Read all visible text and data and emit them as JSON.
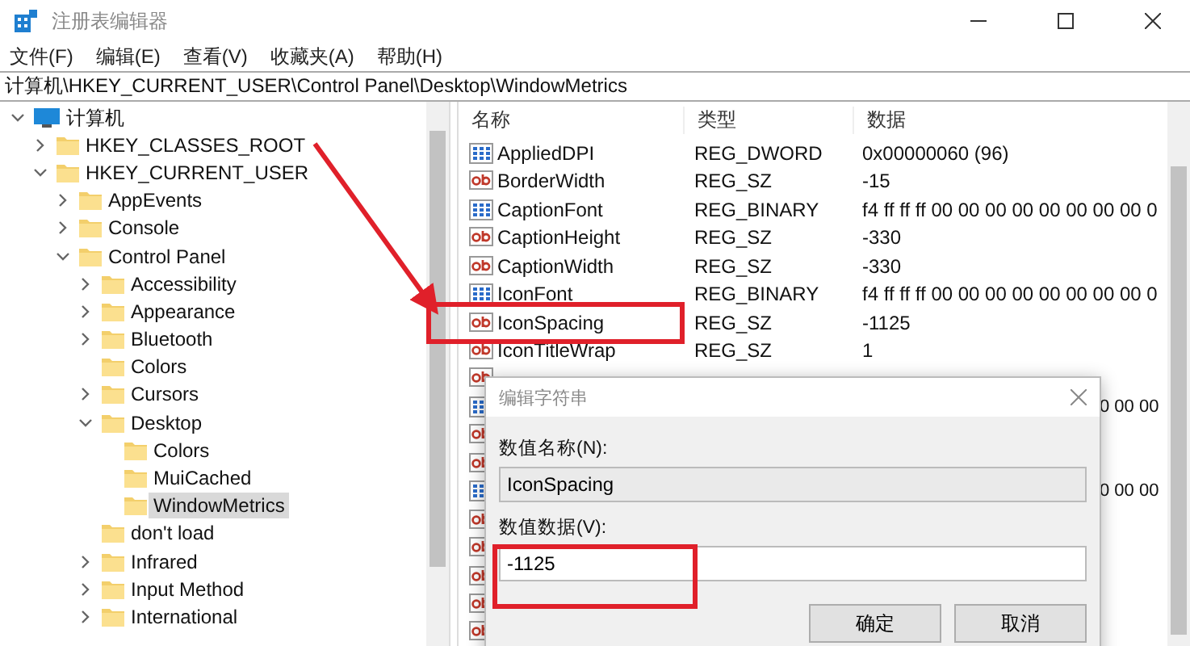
{
  "window": {
    "title": "注册表编辑器"
  },
  "menu": [
    "文件(F)",
    "编辑(E)",
    "查看(V)",
    "收藏夹(A)",
    "帮助(H)"
  ],
  "address": "计算机\\HKEY_CURRENT_USER\\Control Panel\\Desktop\\WindowMetrics",
  "tree": [
    {
      "label": "计算机",
      "kind": "computer",
      "expanded": true,
      "selected": false,
      "children": [
        {
          "label": "HKEY_CLASSES_ROOT",
          "expanded": false,
          "selected": false
        },
        {
          "label": "HKEY_CURRENT_USER",
          "expanded": true,
          "selected": false,
          "children": [
            {
              "label": "AppEvents",
              "expanded": false,
              "selected": false
            },
            {
              "label": "Console",
              "expanded": false,
              "selected": false
            },
            {
              "label": "Control Panel",
              "expanded": true,
              "selected": false,
              "children": [
                {
                  "label": "Accessibility",
                  "expanded": false,
                  "selected": false
                },
                {
                  "label": "Appearance",
                  "expanded": false,
                  "selected": false
                },
                {
                  "label": "Bluetooth",
                  "expanded": false,
                  "selected": false
                },
                {
                  "label": "Colors",
                  "selected": false
                },
                {
                  "label": "Cursors",
                  "expanded": false,
                  "selected": false
                },
                {
                  "label": "Desktop",
                  "expanded": true,
                  "selected": false,
                  "children": [
                    {
                      "label": "Colors",
                      "selected": false
                    },
                    {
                      "label": "MuiCached",
                      "selected": false
                    },
                    {
                      "label": "WindowMetrics",
                      "selected": true
                    }
                  ]
                },
                {
                  "label": "don't load",
                  "selected": false
                },
                {
                  "label": "Infrared",
                  "expanded": false,
                  "selected": false
                },
                {
                  "label": "Input Method",
                  "expanded": false,
                  "selected": false
                },
                {
                  "label": "International",
                  "expanded": false,
                  "selected": false
                }
              ]
            }
          ]
        }
      ]
    }
  ],
  "values": {
    "columns": [
      "名称",
      "类型",
      "数据"
    ],
    "rows": [
      {
        "kind": "binary",
        "name": "AppliedDPI",
        "type": "REG_DWORD",
        "data": "0x00000060 (96)"
      },
      {
        "kind": "string",
        "name": "BorderWidth",
        "type": "REG_SZ",
        "data": "-15"
      },
      {
        "kind": "binary",
        "name": "CaptionFont",
        "type": "REG_BINARY",
        "data": "f4 ff ff ff 00 00 00 00 00 00 00 00 0"
      },
      {
        "kind": "string",
        "name": "CaptionHeight",
        "type": "REG_SZ",
        "data": "-330"
      },
      {
        "kind": "string",
        "name": "CaptionWidth",
        "type": "REG_SZ",
        "data": "-330"
      },
      {
        "kind": "binary",
        "name": "IconFont",
        "type": "REG_BINARY",
        "data": "f4 ff ff ff 00 00 00 00 00 00 00 00 0"
      },
      {
        "kind": "string",
        "name": "IconSpacing",
        "type": "REG_SZ",
        "data": "-1125"
      },
      {
        "kind": "string",
        "name": "IconTitleWrap",
        "type": "REG_SZ",
        "data": "1"
      },
      {
        "kind": "string"
      },
      {
        "kind": "binary",
        "data": "0 00 00"
      },
      {
        "kind": "string"
      },
      {
        "kind": "string"
      },
      {
        "kind": "binary",
        "data": "0 00 00"
      },
      {
        "kind": "string"
      },
      {
        "kind": "string"
      },
      {
        "kind": "string"
      },
      {
        "kind": "string"
      },
      {
        "kind": "string"
      }
    ]
  },
  "dialog": {
    "title": "编辑字符串",
    "name_label": "数值名称(N):",
    "name_value": "IconSpacing",
    "data_label": "数值数据(V):",
    "data_value": "-1125",
    "buttons": [
      "确定",
      "取消"
    ]
  }
}
